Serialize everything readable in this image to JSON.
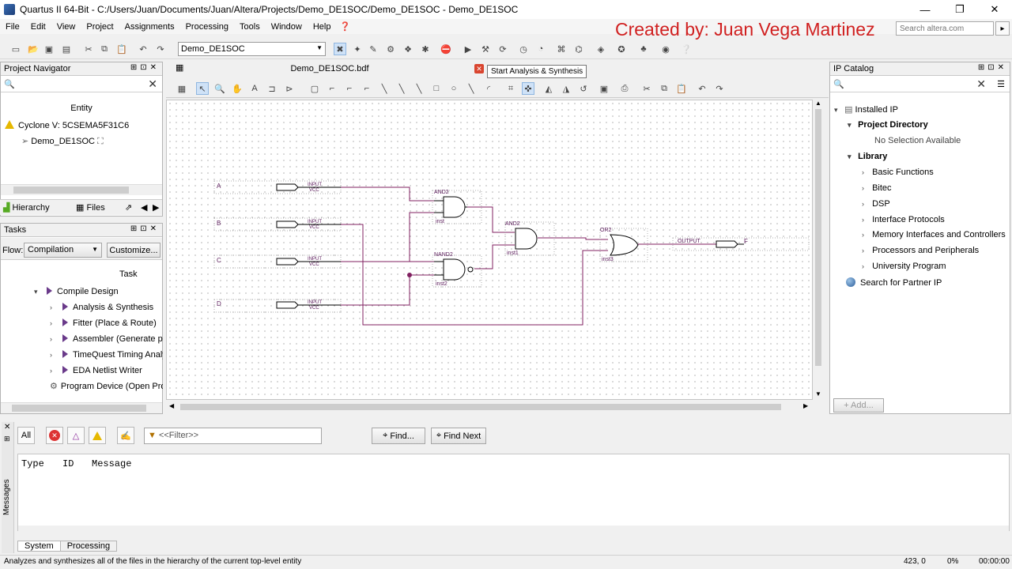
{
  "window": {
    "title": "Quartus II 64-Bit - C:/Users/Juan/Documents/Juan/Altera/Projects/Demo_DE1SOC/Demo_DE1SOC - Demo_DE1SOC",
    "min": "—",
    "restore": "❐",
    "close": "✕"
  },
  "menu": [
    "File",
    "Edit",
    "View",
    "Project",
    "Assignments",
    "Processing",
    "Tools",
    "Window",
    "Help"
  ],
  "overlay_credit": "Created by: Juan Vega Martinez",
  "search": {
    "placeholder": "Search altera.com"
  },
  "toolbar": {
    "revision": "Demo_DE1SOC"
  },
  "tooltip": "Start Analysis & Synthesis",
  "project_navigator": {
    "title": "Project Navigator",
    "column": "Entity",
    "device": "Cyclone V: 5CSEMA5F31C6",
    "entity": "Demo_DE1SOC",
    "tabs": [
      "Hierarchy",
      "Files"
    ]
  },
  "tasks": {
    "title": "Tasks",
    "flow_label": "Flow:",
    "flow_value": "Compilation",
    "customize": "Customize...",
    "column": "Task",
    "items": [
      "Compile Design",
      "Analysis & Synthesis",
      "Fitter (Place & Route)",
      "Assembler (Generate programming files)",
      "TimeQuest Timing Analysis",
      "EDA Netlist Writer",
      "Program Device (Open Programmer)"
    ]
  },
  "document": {
    "tab": "Demo_DE1SOC.bdf"
  },
  "schematic": {
    "inputs": [
      "A",
      "B",
      "C",
      "D"
    ],
    "pin_type": "INPUT",
    "pin_vcc": "VCC",
    "gates": [
      {
        "type": "AND2",
        "inst": "inst"
      },
      {
        "type": "NAND2",
        "inst": "inst2"
      },
      {
        "type": "AND2",
        "inst": "inst1"
      },
      {
        "type": "OR2",
        "inst": "inst3"
      }
    ],
    "output_type": "OUTPUT",
    "output_name": "F"
  },
  "ip_catalog": {
    "title": "IP Catalog",
    "installed": "Installed IP",
    "project_directory": "Project Directory",
    "no_selection": "No Selection Available",
    "library": "Library",
    "library_items": [
      "Basic Functions",
      "Bitec",
      "DSP",
      "Interface Protocols",
      "Memory Interfaces and Controllers",
      "Processors and Peripherals",
      "University Program"
    ],
    "partner": "Search for Partner IP",
    "add_button": "+ Add..."
  },
  "messages": {
    "all": "All",
    "filter_placeholder": "<<Filter>>",
    "find": "Find...",
    "find_next": "Find Next",
    "columns": [
      "Type",
      "ID",
      "Message"
    ],
    "tabs": [
      "System",
      "Processing"
    ],
    "side_label": "Messages"
  },
  "status": {
    "text": "Analyzes and synthesizes all of the files in the hierarchy of the current top-level entity",
    "coords": "423, 0",
    "percent": "0%",
    "time": "00:00:00"
  }
}
